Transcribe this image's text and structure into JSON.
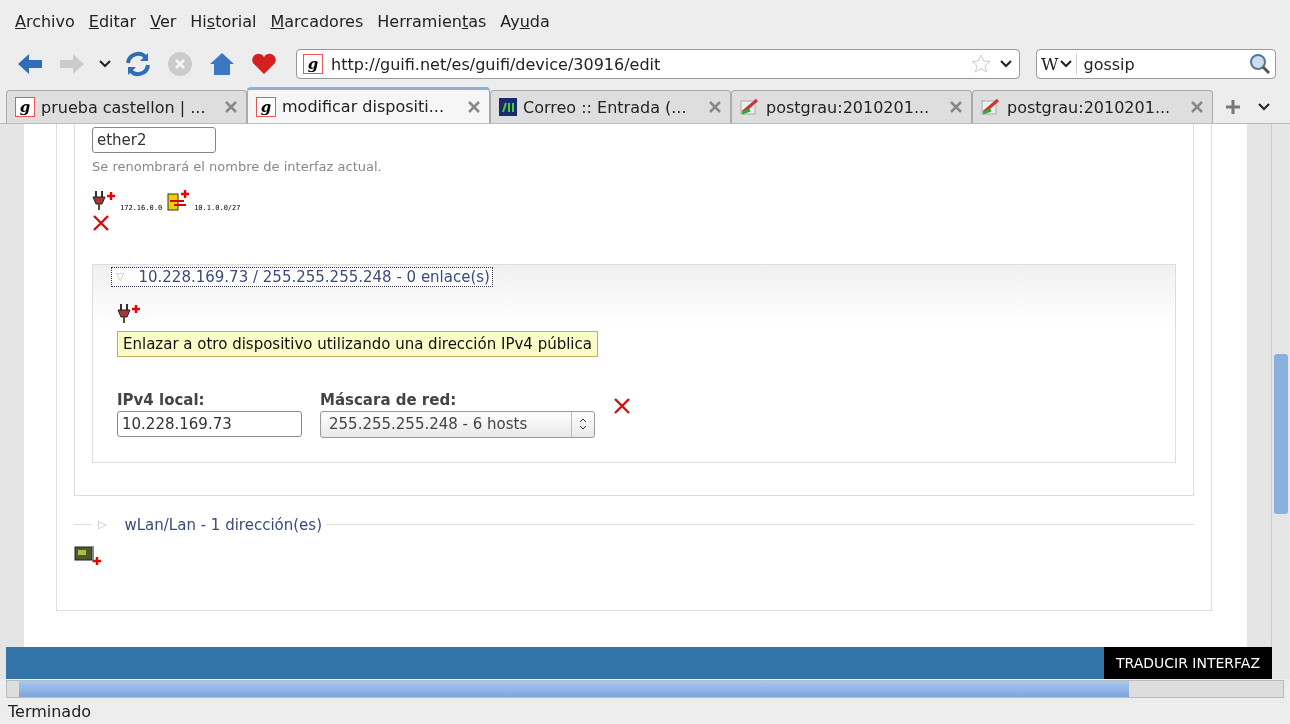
{
  "menu": [
    {
      "key": "A",
      "after": "rchivo"
    },
    {
      "key": "E",
      "after": "ditar"
    },
    {
      "key": "V",
      "after": "er"
    },
    {
      "before": "Hi",
      "key": "s",
      "after": "torial"
    },
    {
      "key": "M",
      "after": "arcadores"
    },
    {
      "before": "Herramien",
      "key": "t",
      "after": "as"
    },
    {
      "before": "Ay",
      "key": "u",
      "after": "da"
    }
  ],
  "navigation": {
    "back_disabled": false,
    "forward_disabled": true,
    "stop_disabled": true,
    "site_logo": "g",
    "url": "http://guifi.net/es/guifi/device/30916/edit",
    "search_engine": "W",
    "search_value": "gossip"
  },
  "tabs": [
    {
      "title": "prueba castellon | ...",
      "kind": "logo",
      "logo": "g",
      "selected": false
    },
    {
      "title": "modificar dispositi...",
      "kind": "logo",
      "logo": "g",
      "selected": true
    },
    {
      "title": "Correo :: Entrada (...",
      "kind": "mail",
      "selected": false
    },
    {
      "title": "postgrau:2010201...",
      "kind": "wiki",
      "selected": false
    },
    {
      "title": "postgrau:2010201...",
      "kind": "wiki",
      "selected": false
    }
  ],
  "interface": {
    "name_value": "ether2",
    "help": "Se renombrará el nombre de interfaz actual.",
    "link_labels": [
      "172.16.0.0",
      "10.1.0.0/27"
    ]
  },
  "address_fieldset": {
    "toggle": "▽",
    "legend": "10.228.169.73 / 255.255.255.248 - 0 enlace(s)",
    "expanded": true,
    "tooltip": "Enlazar a otro dispositivo utilizando una dirección IPv4 pública",
    "ipv4_label": "IPv4 local:",
    "ipv4_value": "10.228.169.73",
    "mask_label": "Máscara de red:",
    "mask_value": "255.255.255.248 - 6 hosts"
  },
  "wlan_fieldset": {
    "toggle": "▷",
    "legend": "wLan/Lan - 1 dirección(es)",
    "expanded": false
  },
  "translate_bar": {
    "label": "TRADUCIR INTERFAZ"
  },
  "status_bar": {
    "text": "Terminado"
  }
}
